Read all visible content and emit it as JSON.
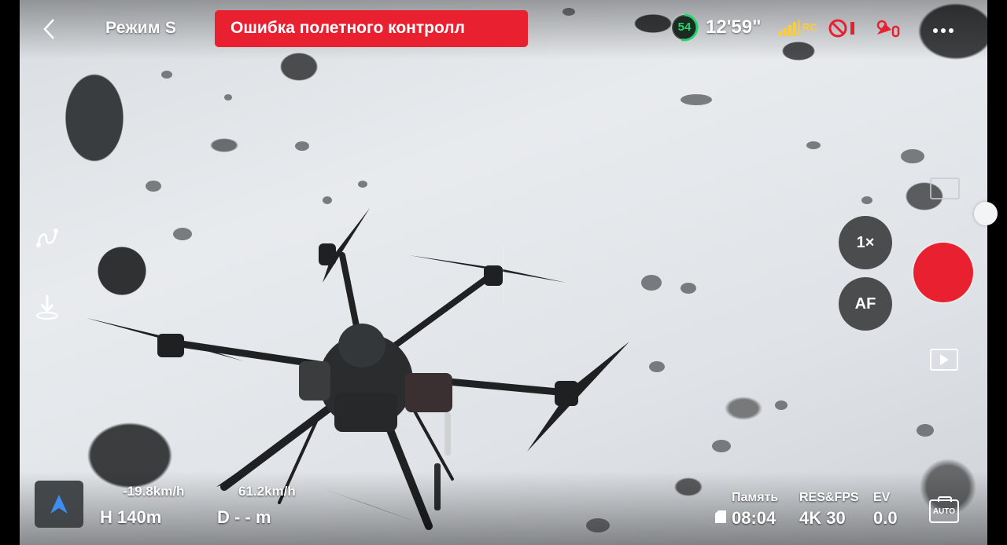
{
  "top_bar": {
    "mode": "Режим S",
    "alert_text": "Ошибка полетного контролл",
    "battery_percent": "54",
    "flight_time": "12'59\"",
    "rc_label": "RC",
    "more_icon": "more-dots-icon"
  },
  "right_controls": {
    "zoom_label": "1×",
    "focus_label": "AF",
    "shutter_color": "#e8202f"
  },
  "telemetry": {
    "vertical_speed": "-19.8km/h",
    "horizontal_speed": "61.2km/h",
    "height": "H 140m",
    "distance": "D - - m"
  },
  "camera": {
    "memory_label": "Память",
    "memory_value": "08:04",
    "res_label": "RES&FPS",
    "res_value": "4K 30",
    "ev_label": "EV",
    "ev_value": "0.0",
    "auto_icon_text": "AUTO"
  },
  "colors": {
    "alert": "#e8202f",
    "battery": "#24d36f",
    "signal": "#ffcc33"
  }
}
